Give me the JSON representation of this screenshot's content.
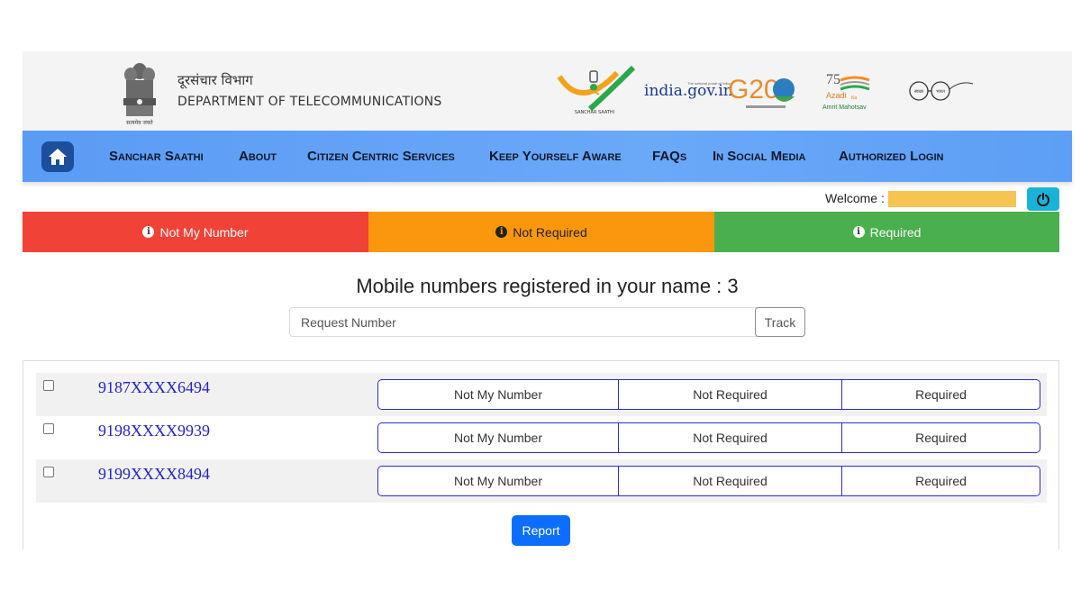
{
  "header": {
    "dept_hindi": "दूरसंचार विभाग",
    "dept_english": "DEPARTMENT OF TELECOMMUNICATIONS",
    "emblem_motto": "सत्यमेव जयते",
    "logos": {
      "sanchar_saathi": "SANCHAR SAATHI",
      "india_gov_i": "i",
      "india_gov_rest": "ndia.gov.in",
      "india_gov_tagline": "The national portal of India",
      "g20": "G20",
      "azadi": "Azadi",
      "azadi_ka": "Ka",
      "amrit_mahotsav": "Amrit Mahotsav",
      "swachh_bharat_1": "स्वच्छ",
      "swachh_bharat_2": "भारत"
    }
  },
  "nav": {
    "home_icon": "home-icon",
    "items": [
      "Sanchar Saathi",
      "About",
      "Citizen Centric Services",
      "Keep Yourself Aware",
      "FAQs",
      "In Social Media",
      "Authorized Login"
    ]
  },
  "welcome": {
    "label": "Welcome :",
    "logout_icon": "power-icon"
  },
  "status_bar": {
    "not_my_number": "Not My Number",
    "not_required": "Not Required",
    "required": "Required",
    "colors": {
      "red": "#f04236",
      "orange": "#fb970c",
      "green": "#4aaf4d"
    }
  },
  "registered": {
    "title": "Mobile numbers registered in your name : 3"
  },
  "request": {
    "placeholder": "Request Number",
    "track_label": "Track"
  },
  "numbers": [
    {
      "number": "9187XXXX6494",
      "opt1": "Not My Number",
      "opt2": "Not Required",
      "opt3": "Required"
    },
    {
      "number": "9198XXXX9939",
      "opt1": "Not My Number",
      "opt2": "Not Required",
      "opt3": "Required"
    },
    {
      "number": "9199XXXX8494",
      "opt1": "Not My Number",
      "opt2": "Not Required",
      "opt3": "Required"
    }
  ],
  "report_label": "Report"
}
